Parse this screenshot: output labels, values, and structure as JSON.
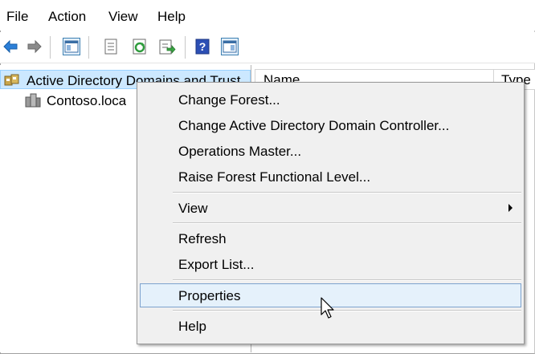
{
  "menubar": {
    "items": [
      "File",
      "Action",
      "View",
      "Help"
    ]
  },
  "toolbar": {
    "icons": [
      "back-arrow-icon",
      "forward-arrow-icon",
      "show-hide-console-tree-icon",
      "properties-icon",
      "refresh-icon",
      "export-list-icon",
      "help-icon",
      "show-hide-action-pane-icon"
    ]
  },
  "tree": {
    "root_label": "Active Directory Domains and Trust",
    "child_label": "Contoso.loca"
  },
  "list": {
    "columns": [
      "Name",
      "Type"
    ]
  },
  "context_menu": {
    "items": [
      "Change Forest...",
      "Change Active Directory Domain Controller...",
      "Operations Master...",
      "Raise Forest Functional Level...",
      "View",
      "Refresh",
      "Export List...",
      "Properties",
      "Help"
    ],
    "highlighted": "Properties"
  },
  "colors": {
    "accent_blue": "#1f6fd1",
    "highlight_bg": "#e5f1fb",
    "highlight_border": "#7da2ce",
    "tree_selected_bg": "#cce8ff"
  }
}
